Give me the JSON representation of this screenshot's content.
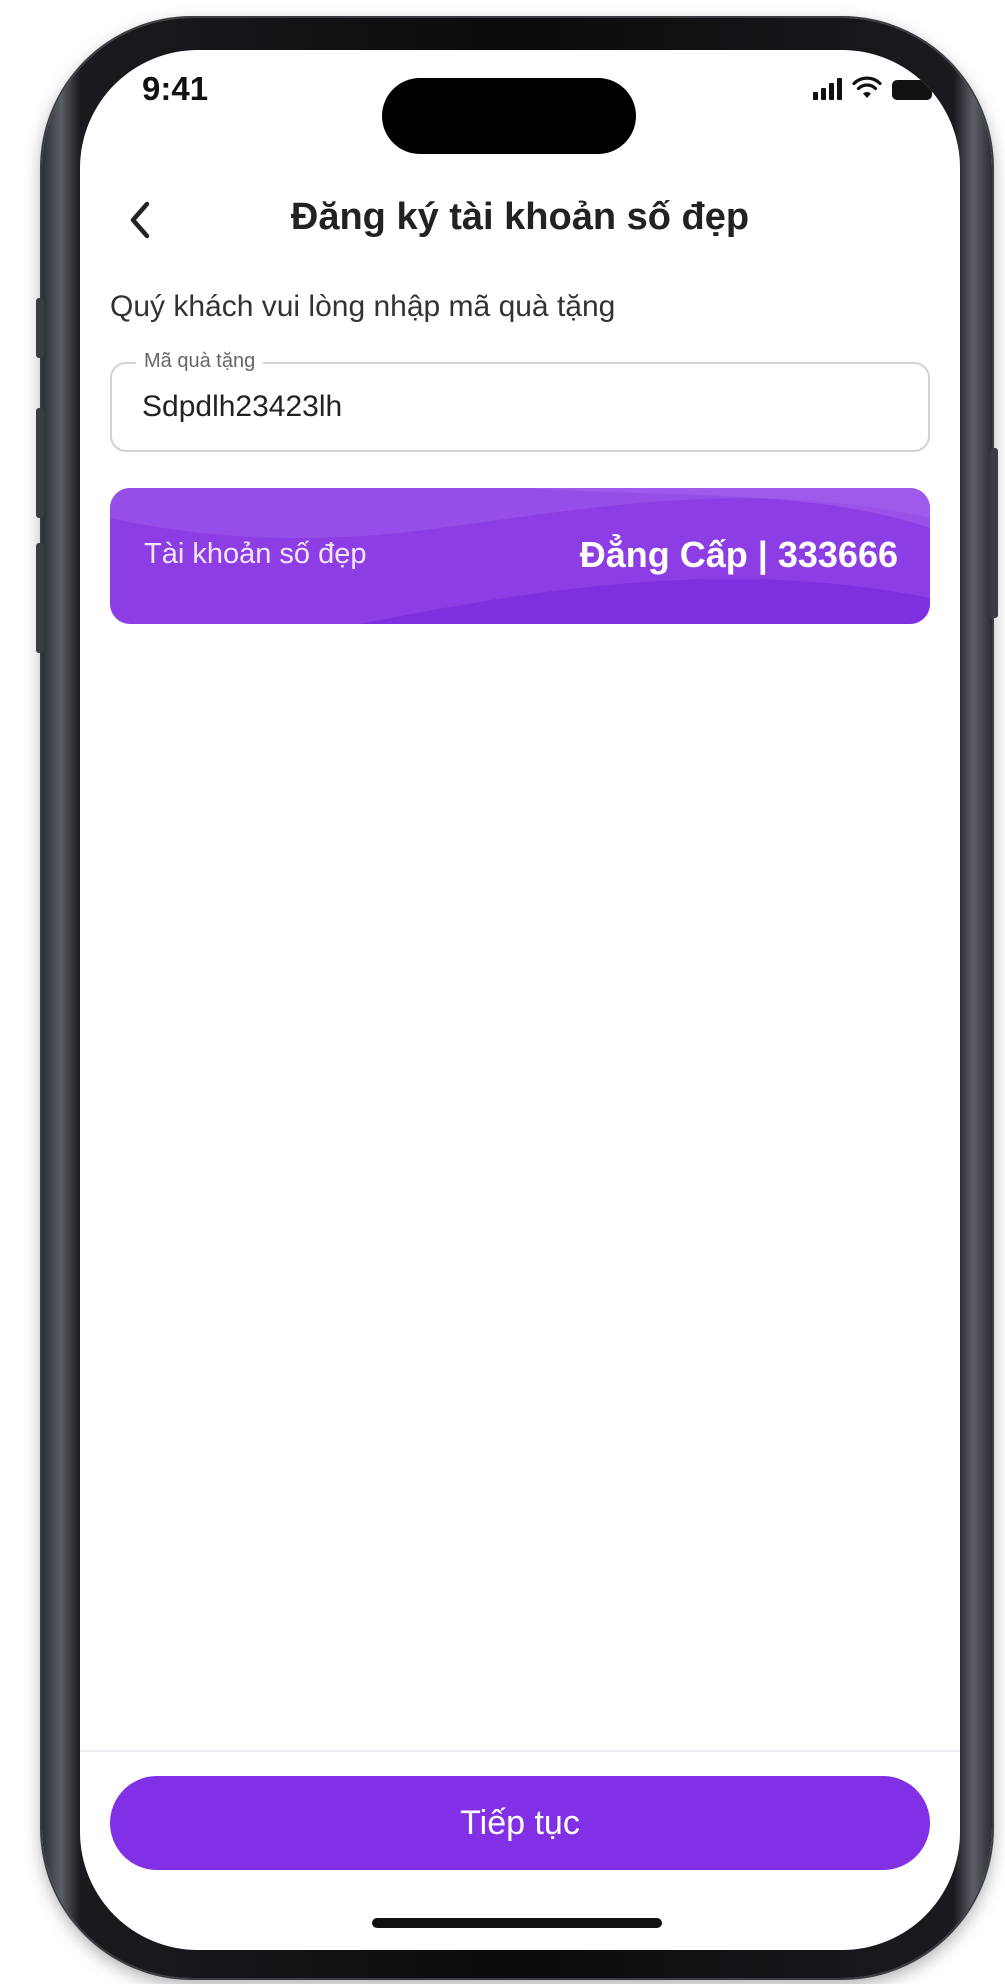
{
  "status_bar": {
    "time": "9:41",
    "icons": [
      "signal-icon",
      "wifi-icon",
      "battery-icon"
    ]
  },
  "header": {
    "back_icon": "chevron-left-icon",
    "title": "Đăng ký tài khoản số đẹp"
  },
  "form": {
    "prompt": "Quý khách vui lòng nhập mã quà tặng",
    "gift_code": {
      "label": "Mã quà tặng",
      "value": "Sdpdlh23423lh"
    }
  },
  "account_card": {
    "label": "Tài khoản số đẹp",
    "value": "Đẳng Cấp | 333666"
  },
  "footer": {
    "continue_label": "Tiếp tục"
  },
  "colors": {
    "primary": "#8130E6",
    "card_background": "#8C3DE3",
    "text": "#222222"
  }
}
